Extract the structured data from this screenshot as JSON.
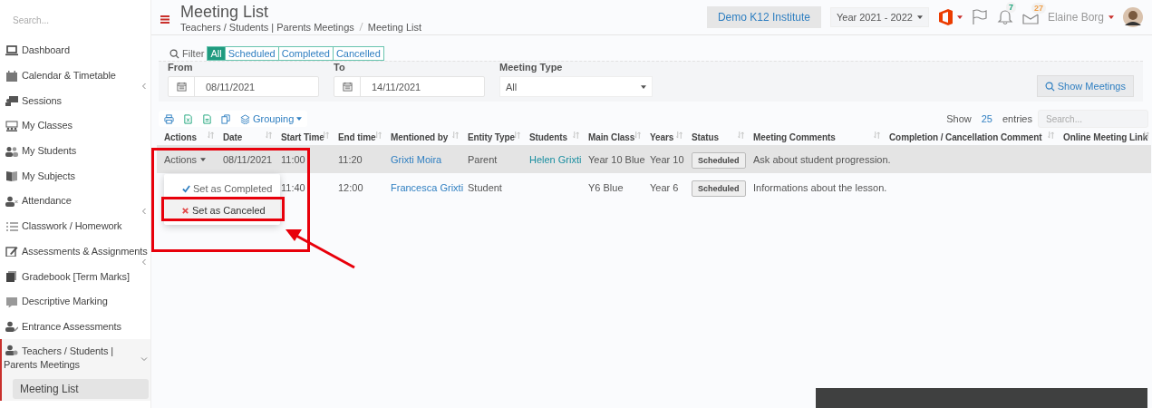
{
  "sidebar": {
    "search_placeholder": "Search...",
    "items": [
      {
        "label": "Dashboard",
        "submenu": false,
        "selected": false
      },
      {
        "label": "Calendar & Timetable",
        "submenu": true,
        "expanded": false,
        "selected": false
      },
      {
        "label": "Sessions",
        "submenu": false,
        "selected": false
      },
      {
        "label": "My Classes",
        "submenu": false,
        "selected": false
      },
      {
        "label": "My Students",
        "submenu": false,
        "selected": false
      },
      {
        "label": "My Subjects",
        "submenu": false,
        "selected": false
      },
      {
        "label": "Attendance",
        "submenu": true,
        "expanded": false,
        "selected": false
      },
      {
        "label": "Classwork / Homework",
        "submenu": false,
        "selected": false
      },
      {
        "label": "Assessments & Assignments",
        "submenu": true,
        "expanded": false,
        "selected": false
      },
      {
        "label": "Gradebook [Term Marks]",
        "submenu": false,
        "selected": false
      },
      {
        "label": "Descriptive Marking",
        "submenu": false,
        "selected": false
      },
      {
        "label": "Entrance Assessments",
        "submenu": false,
        "selected": false
      },
      {
        "label": "Teachers / Students | Parents Meetings",
        "submenu": true,
        "expanded": true,
        "selected": true,
        "children": [
          {
            "label": "Meeting List",
            "selected": true
          }
        ]
      }
    ]
  },
  "header": {
    "title": "Meeting List",
    "breadcrumb": [
      "Teachers / Students | Parents Meetings",
      "Meeting List"
    ],
    "institute": "Demo K12 Institute",
    "year": "Year 2021 - 2022",
    "notifications": "7",
    "messages": "27",
    "user": "Elaine Borg"
  },
  "filter": {
    "label": "Filter",
    "tabs": [
      {
        "label": "All",
        "selected": true
      },
      {
        "label": "Scheduled",
        "selected": false
      },
      {
        "label": "Completed",
        "selected": false
      },
      {
        "label": "Cancelled",
        "selected": false
      }
    ],
    "from": {
      "label": "From",
      "value": "08/11/2021"
    },
    "to": {
      "label": "To",
      "value": "14/11/2021"
    },
    "meeting_type": {
      "label": "Meeting Type",
      "value": "All"
    },
    "button": "Show Meetings"
  },
  "toolbar": {
    "grouping": "Grouping",
    "show": "Show",
    "page_size": "25",
    "entries": "entries",
    "search_placeholder": "Search..."
  },
  "table": {
    "columns": [
      "Actions",
      "Date",
      "Start Time",
      "End time",
      "Mentioned by",
      "Entity Type",
      "Students",
      "Main Class",
      "Years",
      "Status",
      "Meeting Comments",
      "Completion / Cancellation Comment",
      "Online Meeting Link"
    ],
    "rows": [
      {
        "selected": true,
        "actions": "Actions",
        "date": "08/11/2021",
        "start_time": "11:00",
        "end_time": "11:20",
        "mentioned_by": "Grixti Moira",
        "entity_type": "Parent",
        "students": "Helen Grixti",
        "main_class": "Year 10 Blue",
        "years": "Year 10",
        "status": "Scheduled",
        "comments": "Ask about student progression."
      },
      {
        "selected": false,
        "start_time": "11:40",
        "end_time": "12:00",
        "mentioned_by": "Francesca Grixti",
        "entity_type": "Student",
        "main_class": "Y6 Blue",
        "years": "Year 6",
        "status": "Scheduled",
        "comments": "Informations about the lesson."
      }
    ]
  },
  "actions_menu": [
    {
      "label": "Set as Completed",
      "kind": "complete",
      "selected": false
    },
    {
      "label": "Set as Canceled",
      "kind": "cancel",
      "selected": true
    }
  ]
}
